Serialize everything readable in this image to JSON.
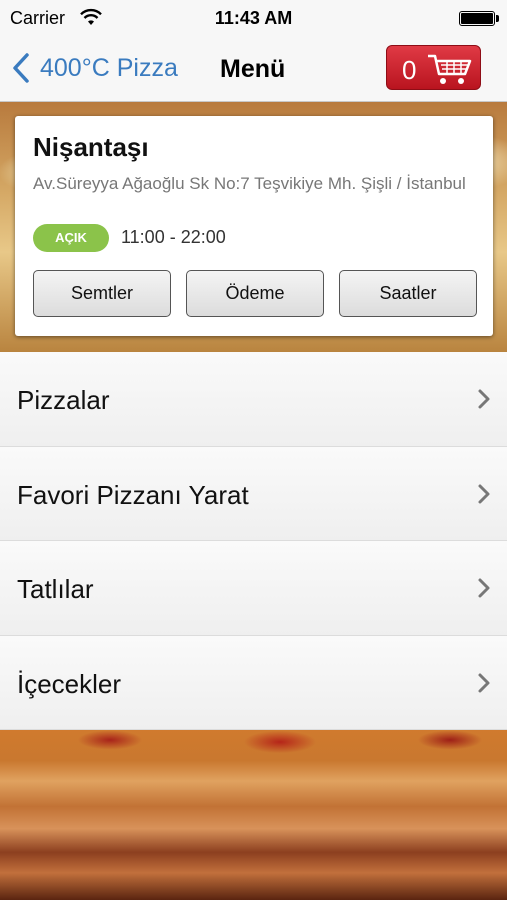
{
  "status_bar": {
    "carrier": "Carrier",
    "time": "11:43 AM",
    "battery_level": 1.0
  },
  "nav": {
    "back_label": "400°C Pizza",
    "title": "Menü",
    "cart_count": "0"
  },
  "store": {
    "name": "Nişantaşı",
    "address": "Av.Süreyya Ağaoğlu Sk No:7 Teşvikiye Mh. Şişli / İstanbul",
    "status_badge": "AÇIK",
    "hours": "11:00 - 22:00",
    "buttons": [
      "Semtler",
      "Ödeme",
      "Saatler"
    ]
  },
  "menu": {
    "items": [
      "Pizzalar",
      "Favori Pizzanı Yarat",
      "Tatlılar",
      "İçecekler"
    ]
  },
  "colors": {
    "accent_blue": "#3a7bbf",
    "cart_red": "#d3202d",
    "open_green": "#8bc34a"
  }
}
